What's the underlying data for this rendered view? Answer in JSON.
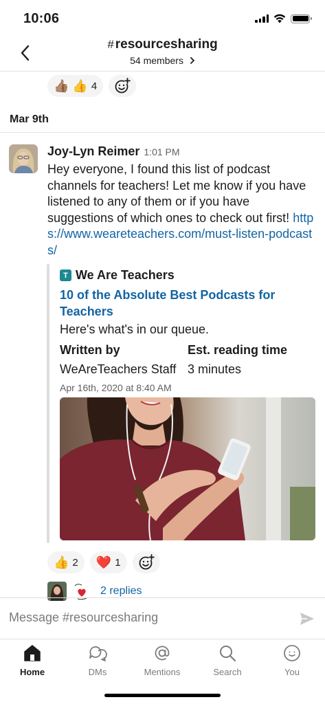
{
  "status_bar": {
    "time": "10:06"
  },
  "header": {
    "hash": "#",
    "channel_name": "resourcesharing",
    "members": "54 members"
  },
  "top_reactions": [
    {
      "emoji": "👍🏽",
      "count": ""
    },
    {
      "emoji": "👍",
      "count": "4"
    }
  ],
  "date_divider": "Mar 9th",
  "message": {
    "author": "Joy-Lyn Reimer",
    "time": "1:01 PM",
    "text": "Hey everyone, I found this list of podcast channels for teachers! Let me know if you have listened to any of them or if you have suggestions of which ones to check out first!",
    "link": "https://www.weareteachers.com/must-listen-podcasts/"
  },
  "unfurl": {
    "site_icon_letter": "T",
    "site_name": "We Are Teachers",
    "title": "10 of the Absolute Best Podcasts for Teachers",
    "description": "Here's what's in our queue.",
    "fields": [
      {
        "label": "Written by",
        "value": "WeAreTeachers Staff"
      },
      {
        "label": "Est. reading time",
        "value": "3 minutes"
      }
    ],
    "date": "Apr 16th, 2020 at 8:40 AM"
  },
  "message_reactions": [
    {
      "emoji": "👍",
      "count": "2"
    },
    {
      "emoji": "❤️",
      "count": "1"
    }
  ],
  "thread": {
    "replies": "2 replies"
  },
  "composer": {
    "placeholder": "Message #resourcesharing"
  },
  "tabs": [
    {
      "label": "Home",
      "icon": "home-icon",
      "active": true
    },
    {
      "label": "DMs",
      "icon": "dms-icon",
      "active": false
    },
    {
      "label": "Mentions",
      "icon": "at-icon",
      "active": false
    },
    {
      "label": "Search",
      "icon": "search-icon",
      "active": false
    },
    {
      "label": "You",
      "icon": "you-icon",
      "active": false
    }
  ],
  "colors": {
    "link": "#1264a3",
    "text": "#1d1c1d",
    "muted": "#616061",
    "unfurl_bar": "#dddddd",
    "reaction_bg": "#f4f4f4"
  }
}
